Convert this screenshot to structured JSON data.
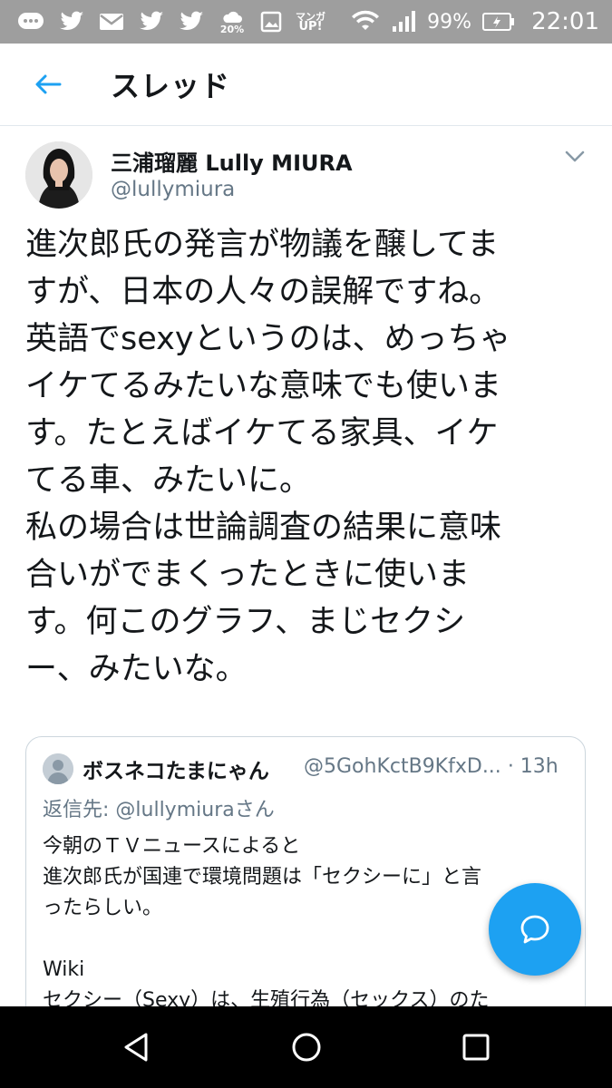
{
  "status_bar": {
    "icons": [
      "chat-bubble-icon",
      "twitter-bird-icon",
      "mail-icon",
      "twitter-bird-icon",
      "twitter-bird-icon",
      "weather-cloud-icon",
      "image-icon",
      "manga-up-icon"
    ],
    "weather_percent": "20%",
    "manga_label_top": "マンガ",
    "manga_label_bottom": "UP!",
    "battery": "99%",
    "time": "22:01"
  },
  "app_bar": {
    "title": "スレッド"
  },
  "tweet": {
    "author_name": "三浦瑠麗 Lully MIURA",
    "author_handle": "@lullymiura",
    "lines": [
      "進次郎氏の発言が物議を醸してま",
      "すが、日本の人々の誤解ですね。",
      "英語でsexyというのは、めっちゃ",
      "イケてるみたいな意味でも使いま",
      "す。たとえばイケてる家具、イケ",
      "てる車、みたいに。",
      "私の場合は世論調査の結果に意味",
      "合いがでまくったときに使いま",
      "す。何このグラフ、まじセクシ",
      "ー、みたいな。"
    ]
  },
  "quote": {
    "author_name": "ボスネコたまにゃん",
    "author_handle": "@5GohKctB9KfxD...",
    "time": "· 13h",
    "reply_prefix": "返信先: ",
    "reply_target": "@lullymiuraさん",
    "lines": [
      "今朝のＴＶニュースによると",
      "進次郎氏が国連で環境問題は「セクシーに」と言",
      "ったらしい。",
      "",
      "Wiki",
      "セクシー（Sexy）は、生殖行為（セックス）のた"
    ]
  },
  "colors": {
    "accent": "#1da1f2",
    "status_bar": "#9e9e9e",
    "secondary_text": "#657786",
    "border": "#ccd6dd"
  }
}
